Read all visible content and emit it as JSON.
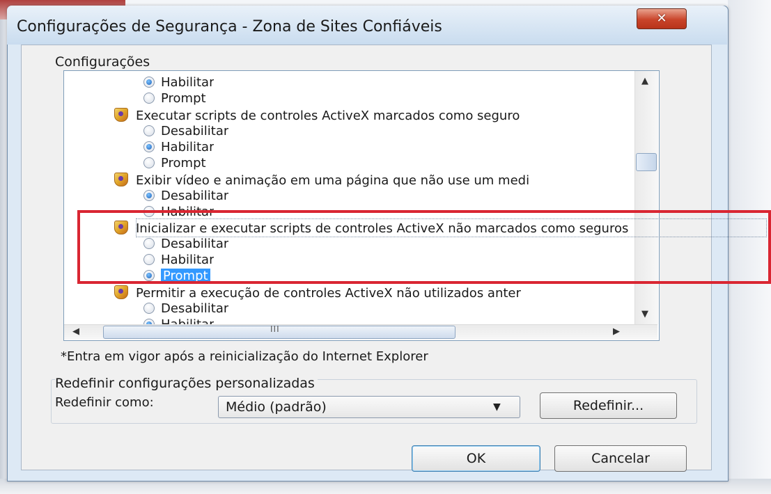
{
  "window": {
    "title": "Configurações de Segurança - Zona de Sites Confiáveis",
    "close_glyph": "✕"
  },
  "settings_group": {
    "label": "Configurações",
    "items": [
      {
        "kind": "option",
        "label": "Habilitar",
        "selected": true
      },
      {
        "kind": "option",
        "label": "Prompt",
        "selected": false
      },
      {
        "kind": "setting",
        "label": "Executar scripts de controles ActiveX marcados como seguro"
      },
      {
        "kind": "option",
        "label": "Desabilitar",
        "selected": false
      },
      {
        "kind": "option",
        "label": "Habilitar",
        "selected": true
      },
      {
        "kind": "option",
        "label": "Prompt",
        "selected": false
      },
      {
        "kind": "setting",
        "label": "Exibir vídeo e animação em uma página que não use um medi"
      },
      {
        "kind": "option",
        "label": "Desabilitar",
        "selected": true
      },
      {
        "kind": "option",
        "label": "Habilitar",
        "selected": false
      },
      {
        "kind": "setting",
        "label": "Inicializar e executar scripts de controles ActiveX não marcados como seguros"
      },
      {
        "kind": "option",
        "label": "Desabilitar",
        "selected": false
      },
      {
        "kind": "option",
        "label": "Habilitar",
        "selected": false
      },
      {
        "kind": "option",
        "label": "Prompt",
        "selected": true
      },
      {
        "kind": "setting",
        "label": "Permitir a execução de controles ActiveX não utilizados anter"
      },
      {
        "kind": "option",
        "label": "Desabilitar",
        "selected": false
      },
      {
        "kind": "option",
        "label": "Habilitar",
        "selected": true
      }
    ],
    "scrollbar_grip": "III",
    "arrows": {
      "up": "▲",
      "down": "▼",
      "left": "◀",
      "right": "▶"
    }
  },
  "note": "*Entra em vigor após a reinicialização do Internet Explorer",
  "reset_group": {
    "label": "Redefinir configurações personalizadas",
    "reset_as_label": "Redefinir como:",
    "selected_level": "Médio (padrão)",
    "dropdown_glyph": "▼",
    "reset_button": "Redefinir..."
  },
  "footer": {
    "ok_button": "OK",
    "cancel_button": "Cancelar"
  },
  "colors": {
    "highlight_border": "#d92632",
    "selection": "#3399ff"
  }
}
